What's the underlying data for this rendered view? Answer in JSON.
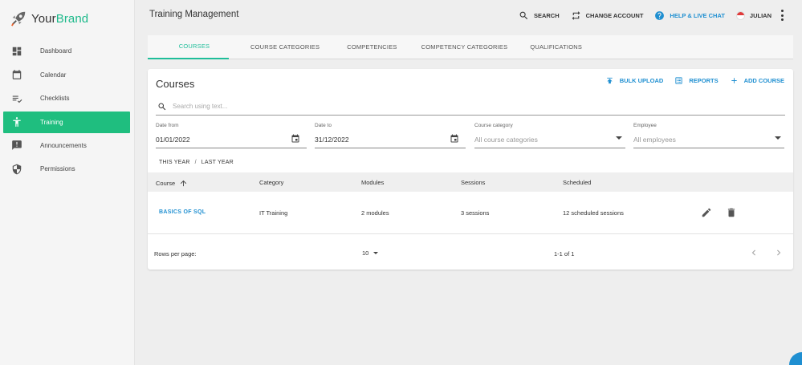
{
  "brand": {
    "prefix": "Your",
    "suffix": "Brand",
    "icon": "rocket-logo-icon"
  },
  "colors": {
    "accent": "#1fbe7f",
    "tab_accent": "#1fbe9a",
    "link": "#1f8fd1"
  },
  "sidebar": {
    "items": [
      {
        "label": "Dashboard",
        "icon": "dashboard-icon"
      },
      {
        "label": "Calendar",
        "icon": "calendar-icon"
      },
      {
        "label": "Checklists",
        "icon": "checklist-icon"
      },
      {
        "label": "Training",
        "icon": "person-icon",
        "active": true
      },
      {
        "label": "Announcements",
        "icon": "announcement-icon"
      },
      {
        "label": "Permissions",
        "icon": "shield-icon"
      }
    ]
  },
  "header": {
    "title": "Training Management",
    "search": "SEARCH",
    "change_account": "CHANGE ACCOUNT",
    "help": "HELP & LIVE CHAT",
    "user": "JULIAN"
  },
  "tabs": [
    "COURSES",
    "COURSE CATEGORIES",
    "COMPETENCIES",
    "COMPETENCY CATEGORIES",
    "QUALIFICATIONS"
  ],
  "courses": {
    "title": "Courses",
    "actions": {
      "bulk_upload": "BULK UPLOAD",
      "reports": "REPORTS",
      "add_course": "ADD COURSE"
    },
    "search_placeholder": "Search using text...",
    "filters": {
      "date_from": {
        "label": "Date from",
        "value": "01/01/2022"
      },
      "date_to": {
        "label": "Date to",
        "value": "31/12/2022"
      },
      "course_category": {
        "label": "Course category",
        "placeholder": "All course categories"
      },
      "employee": {
        "label": "Employee",
        "placeholder": "All employees"
      }
    },
    "quick": {
      "this_year": "THIS YEAR",
      "separator": "/",
      "last_year": "LAST YEAR"
    },
    "table": {
      "columns": [
        "Course",
        "Category",
        "Modules",
        "Sessions",
        "Scheduled"
      ],
      "rows": [
        {
          "course": "BASICS OF SQL",
          "category": "IT Training",
          "modules": "2 modules",
          "sessions": "3 sessions",
          "scheduled": "12 scheduled sessions"
        }
      ]
    },
    "footer": {
      "rows_per_page_label": "Rows per page:",
      "rows_per_page": "10",
      "range": "1-1 of 1"
    }
  }
}
